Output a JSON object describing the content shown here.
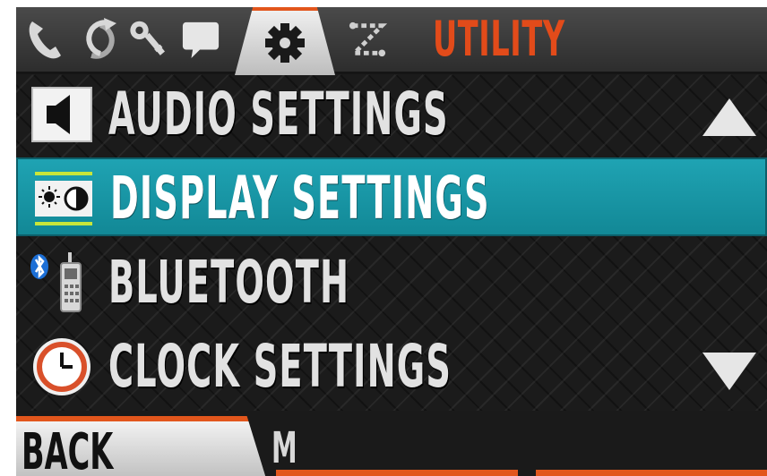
{
  "tabs": [
    {
      "icon": "phone-icon"
    },
    {
      "icon": "sync-icon"
    },
    {
      "icon": "key-icon"
    },
    {
      "icon": "speech-bubble-icon"
    },
    {
      "icon": "gear-icon",
      "active": true
    },
    {
      "icon": "route-icon"
    }
  ],
  "header": {
    "title": "UTILITY",
    "title_color": "#e24b1a"
  },
  "menu": {
    "items": [
      {
        "label": "AUDIO SETTINGS",
        "icon": "speaker-icon"
      },
      {
        "label": "DISPLAY SETTINGS",
        "icon": "display-brightness-icon",
        "selected": true
      },
      {
        "label": "BLUETOOTH",
        "icon": "bluetooth-phone-icon"
      },
      {
        "label": "CLOCK SETTINGS",
        "icon": "clock-icon"
      }
    ],
    "selected_color": "#1fa3b3"
  },
  "bottom": {
    "back_label": "BACK",
    "partial_label": "M"
  },
  "accent_color": "#e2561c"
}
